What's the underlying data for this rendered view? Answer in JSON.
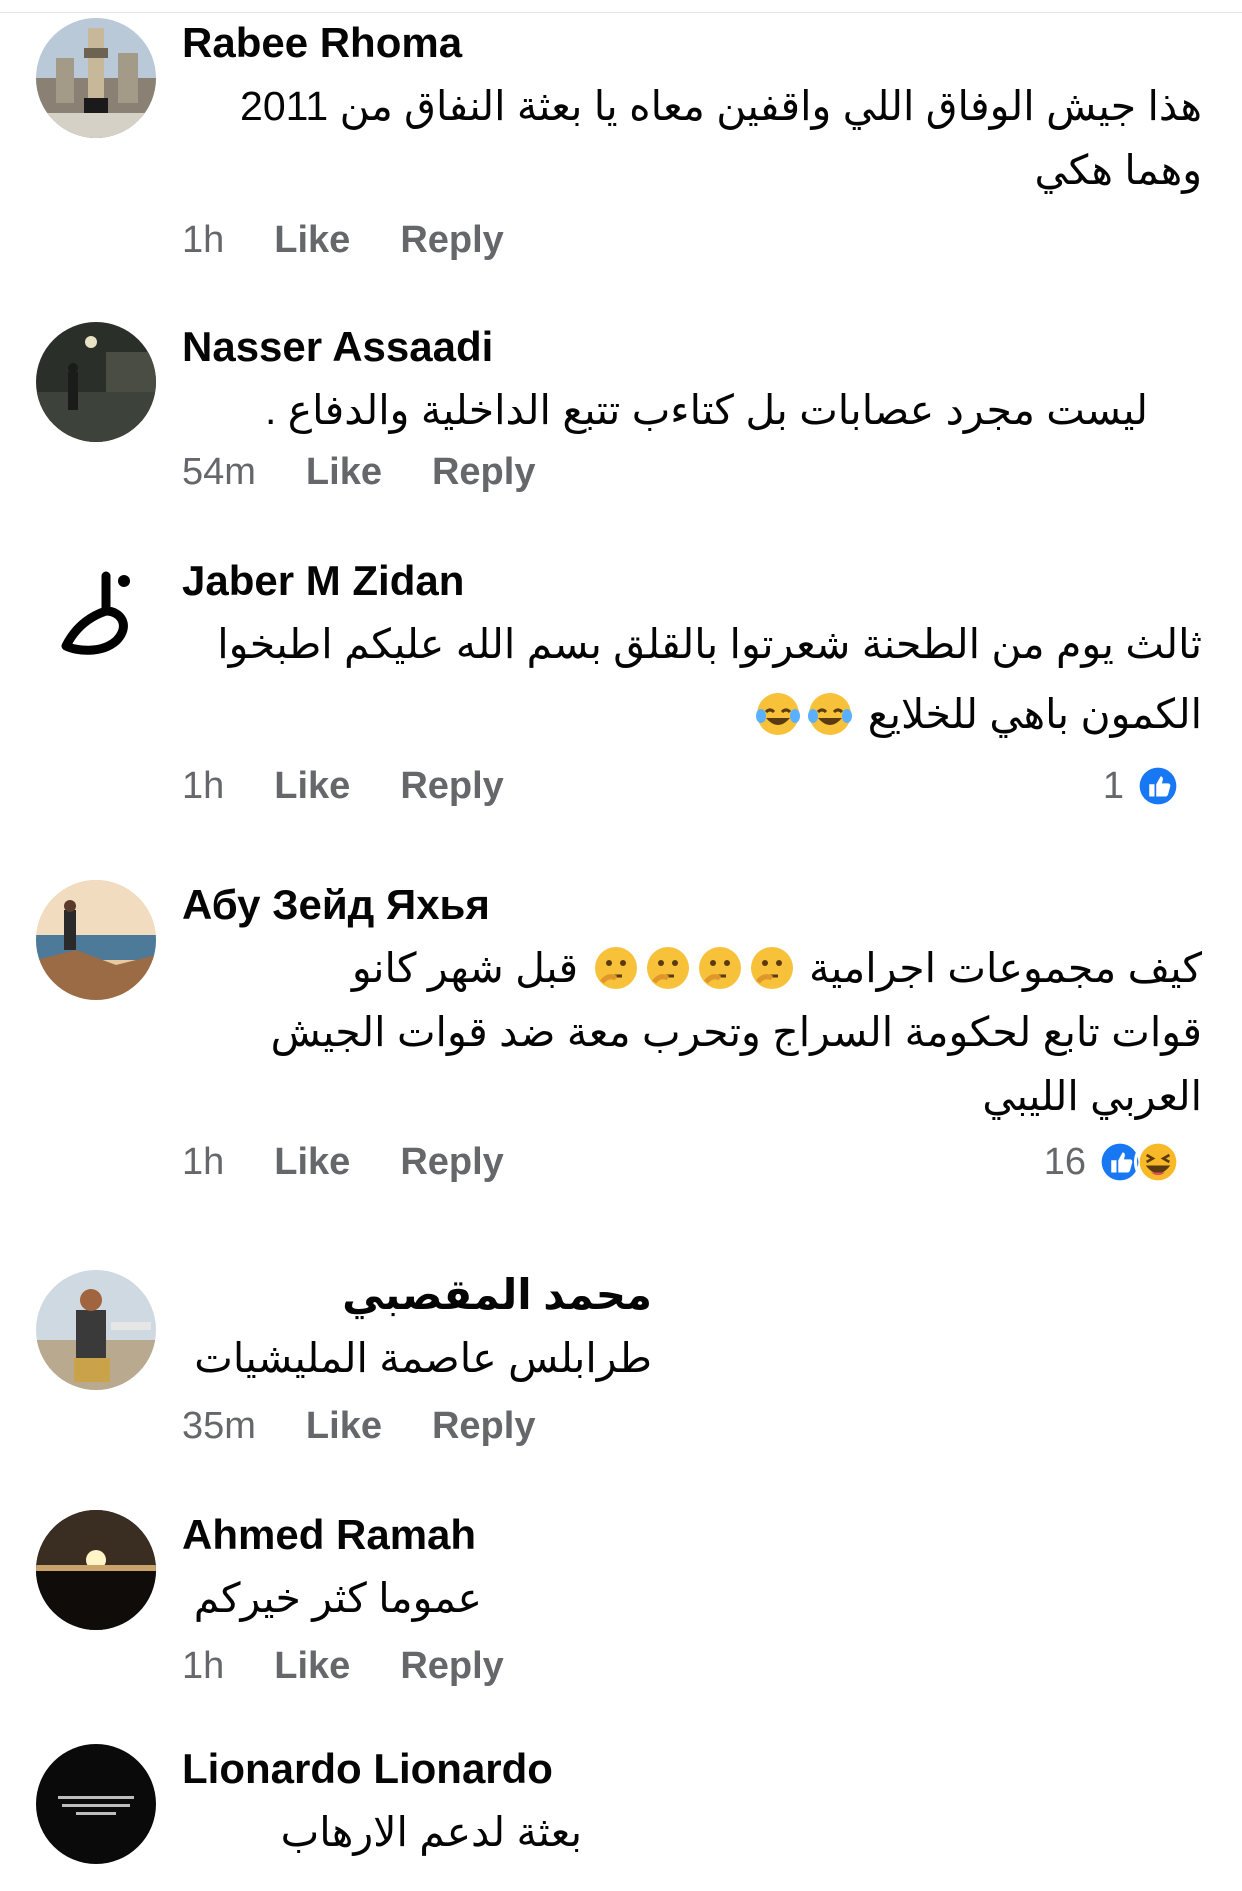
{
  "comments": [
    {
      "author": "Rabee Rhoma",
      "avatar_icon": "mecca-clock-tower-photo",
      "lines": [
        "هذا جيش الوفاق اللي واقفين معاه يا بعثة النفاق من 2011",
        "وهما هكي"
      ],
      "time": "1h",
      "like_label": "Like",
      "reply_label": "Reply"
    },
    {
      "author": "Nasser Assaadi",
      "avatar_icon": "night-street-photo",
      "lines": [
        "ليست مجرد عصابات بل كتاءب تتبع الداخلية والدفاع ."
      ],
      "time": "54m",
      "like_label": "Like",
      "reply_label": "Reply"
    },
    {
      "author": "Jaber M Zidan",
      "avatar_icon": "arabic-calligraphy-logo",
      "lines": [
        "ثالث يوم من الطحنة شعرتوا بالقلق بسم الله عليكم اطبخوا",
        "الكمون باهي للخلايع"
      ],
      "line_emojis": [
        [],
        [
          "laughing-tears-emoji",
          "laughing-tears-emoji"
        ]
      ],
      "time": "1h",
      "like_label": "Like",
      "reply_label": "Reply",
      "reaction_count": "1",
      "reaction_icons": [
        "like-reaction-icon"
      ]
    },
    {
      "author": "Абу Зейд Яхья",
      "avatar_icon": "seaside-rocks-photo",
      "lines": [
        "كيف  مجموعات اجرامية",
        "قبل  شهر  كانو",
        "قوات تابع  لحكومة السراج  وتحرب معة  ضد  قوات الجيش",
        "العربي الليبي"
      ],
      "thinking_emojis": [
        "thinking-emoji",
        "thinking-emoji",
        "thinking-emoji",
        "thinking-emoji"
      ],
      "time": "1h",
      "like_label": "Like",
      "reply_label": "Reply",
      "reaction_count": "16",
      "reaction_icons": [
        "like-reaction-icon",
        "haha-reaction-icon"
      ]
    },
    {
      "author": "محمد المقصبي",
      "avatar_icon": "airport-man-photo",
      "lines": [
        "طرابلس عاصمة المليشيات"
      ],
      "time": "35m",
      "like_label": "Like",
      "reply_label": "Reply"
    },
    {
      "author": "Ahmed Ramah",
      "avatar_icon": "sunset-photo",
      "lines": [
        "عموما كثر خيركم"
      ],
      "time": "1h",
      "like_label": "Like",
      "reply_label": "Reply"
    },
    {
      "author": "Lionardo Lionardo",
      "avatar_icon": "black-text-image",
      "lines": [
        "بعثة لدعم الارهاب"
      ],
      "time": "",
      "like_label": "",
      "reply_label": ""
    }
  ],
  "colors": {
    "name": "#050505",
    "meta": "#65676b",
    "like_blue": "#1877f2",
    "haha_yellow": "#f7b928"
  }
}
